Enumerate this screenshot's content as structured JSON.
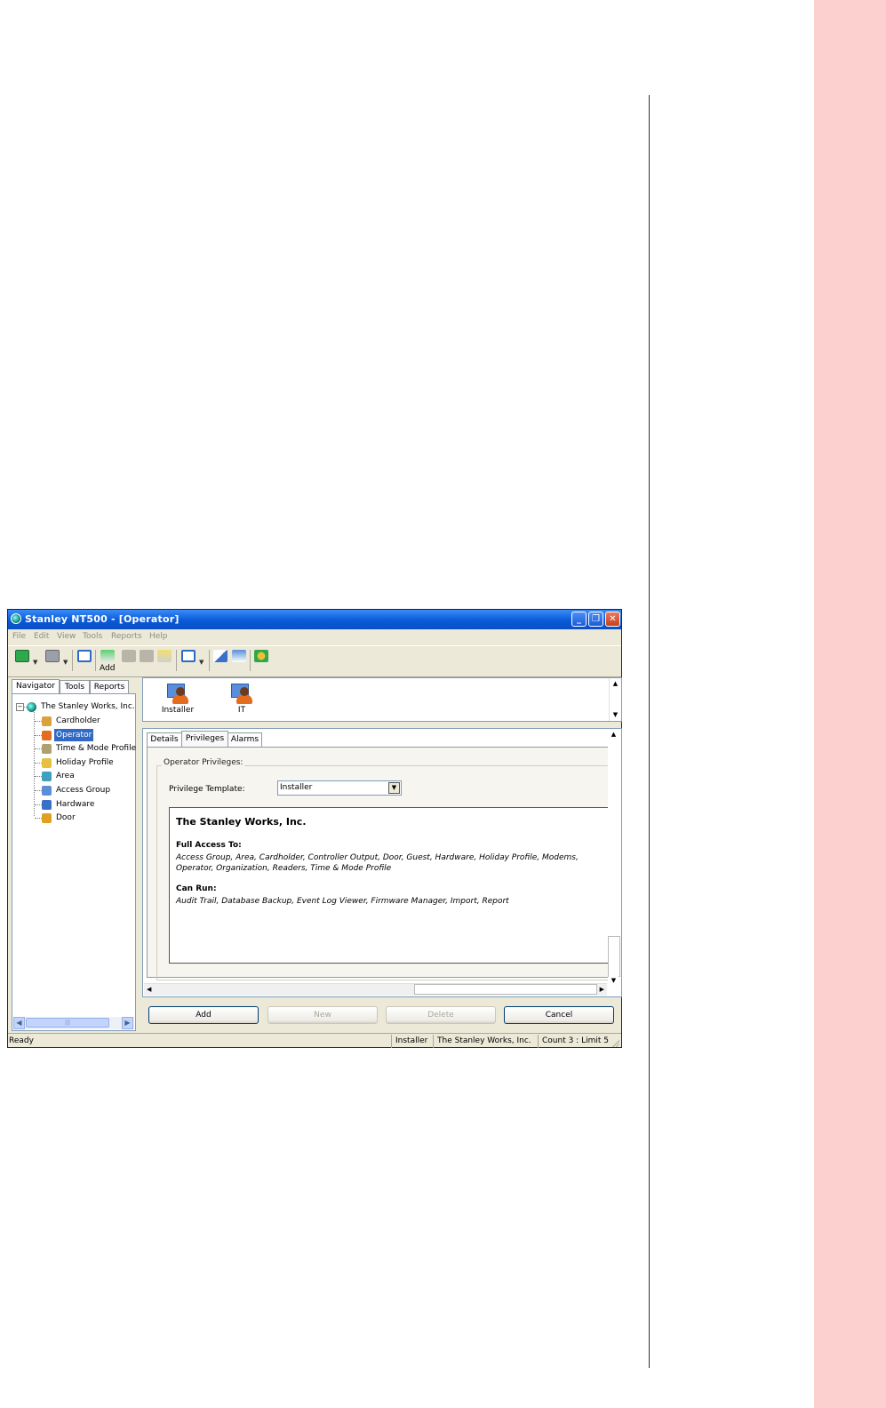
{
  "window": {
    "title": "Stanley NT500 - [Operator]",
    "controls": {
      "minimize": "_",
      "restore": "❐",
      "close": "✕"
    }
  },
  "menu": [
    "File",
    "Edit",
    "View",
    "Tools",
    "Reports",
    "Help"
  ],
  "toolbar": {
    "add_label": "Add"
  },
  "navigator": {
    "tabs": [
      "Navigator",
      "Tools",
      "Reports"
    ],
    "root": "The Stanley Works, Inc.",
    "expander": "−",
    "items": [
      {
        "label": "Cardholder",
        "icon": "cardholder-icon",
        "color": "#d9a23a"
      },
      {
        "label": "Operator",
        "icon": "operator-icon",
        "color": "#e36d1e",
        "selected": true
      },
      {
        "label": "Time & Mode Profile",
        "icon": "clock-icon",
        "color": "#b0a070"
      },
      {
        "label": "Holiday Profile",
        "icon": "holiday-icon",
        "color": "#e8c040"
      },
      {
        "label": "Area",
        "icon": "area-icon",
        "color": "#3fa0c0"
      },
      {
        "label": "Access Group",
        "icon": "access-group-icon",
        "color": "#5a8ed8"
      },
      {
        "label": "Hardware",
        "icon": "hardware-icon",
        "color": "#3a70c8"
      },
      {
        "label": "Door",
        "icon": "door-icon",
        "color": "#e0a020"
      }
    ],
    "scroll_grip": "|||"
  },
  "operators": [
    {
      "label": "Installer"
    },
    {
      "label": "IT"
    }
  ],
  "detail_tabs": [
    "Details",
    "Privileges",
    "Alarms"
  ],
  "privileges": {
    "group_label": "Operator Privileges:",
    "template_label": "Privilege Template:",
    "template_value": "Installer",
    "org": "The Stanley Works, Inc.",
    "full_access_heading": "Full Access To:",
    "full_access_text": "Access Group, Area, Cardholder, Controller Output, Door, Guest, Hardware, Holiday Profile, Modems, Operator, Organization, Readers, Time & Mode Profile",
    "can_run_heading": "Can Run:",
    "can_run_text": "Audit Trail, Database Backup, Event Log Viewer, Firmware Manager, Import, Report"
  },
  "buttons": {
    "add": "Add",
    "new": "New",
    "delete": "Delete",
    "cancel": "Cancel"
  },
  "status": {
    "ready": "Ready",
    "user": "Installer",
    "org": "The Stanley Works, Inc.",
    "count": "Count 3 : Limit 5"
  },
  "colors": {
    "side_band": "#fdd0d0",
    "titlebar": "#0a5ad8",
    "selection": "#316ac5"
  }
}
